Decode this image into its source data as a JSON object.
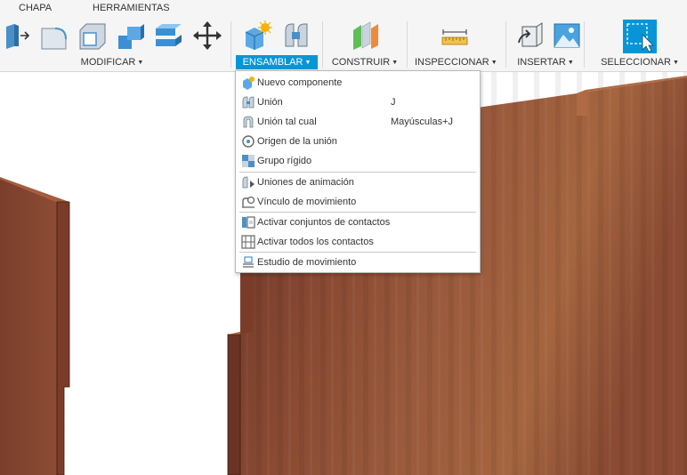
{
  "tabs": [
    "CHAPA",
    "HERRAMIENTAS"
  ],
  "groups": {
    "modificar": "MODIFICAR",
    "ensamblar": "ENSAMBLAR",
    "construir": "CONSTRUIR",
    "inspeccionar": "INSPECCIONAR",
    "insertar": "INSERTAR",
    "seleccionar": "SELECCIONAR"
  },
  "menu": {
    "items": [
      {
        "label": "Nuevo componente",
        "shortcut": "",
        "icon": "new-component-icon"
      },
      {
        "label": "Unión",
        "shortcut": "J",
        "icon": "joint-icon"
      },
      {
        "label": "Unión tal cual",
        "shortcut": "Mayúsculas+J",
        "icon": "as-built-joint-icon"
      },
      {
        "label": "Origen de la unión",
        "shortcut": "",
        "icon": "joint-origin-icon"
      },
      {
        "label": "Grupo rígido",
        "shortcut": "",
        "icon": "rigid-group-icon"
      },
      {
        "label": "Uniones de animación",
        "shortcut": "",
        "icon": "animate-joints-icon"
      },
      {
        "label": "Vínculo de movimiento",
        "shortcut": "",
        "icon": "motion-link-icon"
      },
      {
        "label": "Activar conjuntos de contactos",
        "shortcut": "",
        "icon": "contact-sets-icon"
      },
      {
        "label": "Activar todos los contactos",
        "shortcut": "",
        "icon": "all-contacts-icon"
      },
      {
        "label": "Estudio de movimiento",
        "shortcut": "",
        "icon": "motion-study-icon"
      }
    ]
  },
  "colors": {
    "accent": "#0696d7",
    "wood": "#7a3f2c",
    "toolbar_bg": "#f5f5f5"
  }
}
